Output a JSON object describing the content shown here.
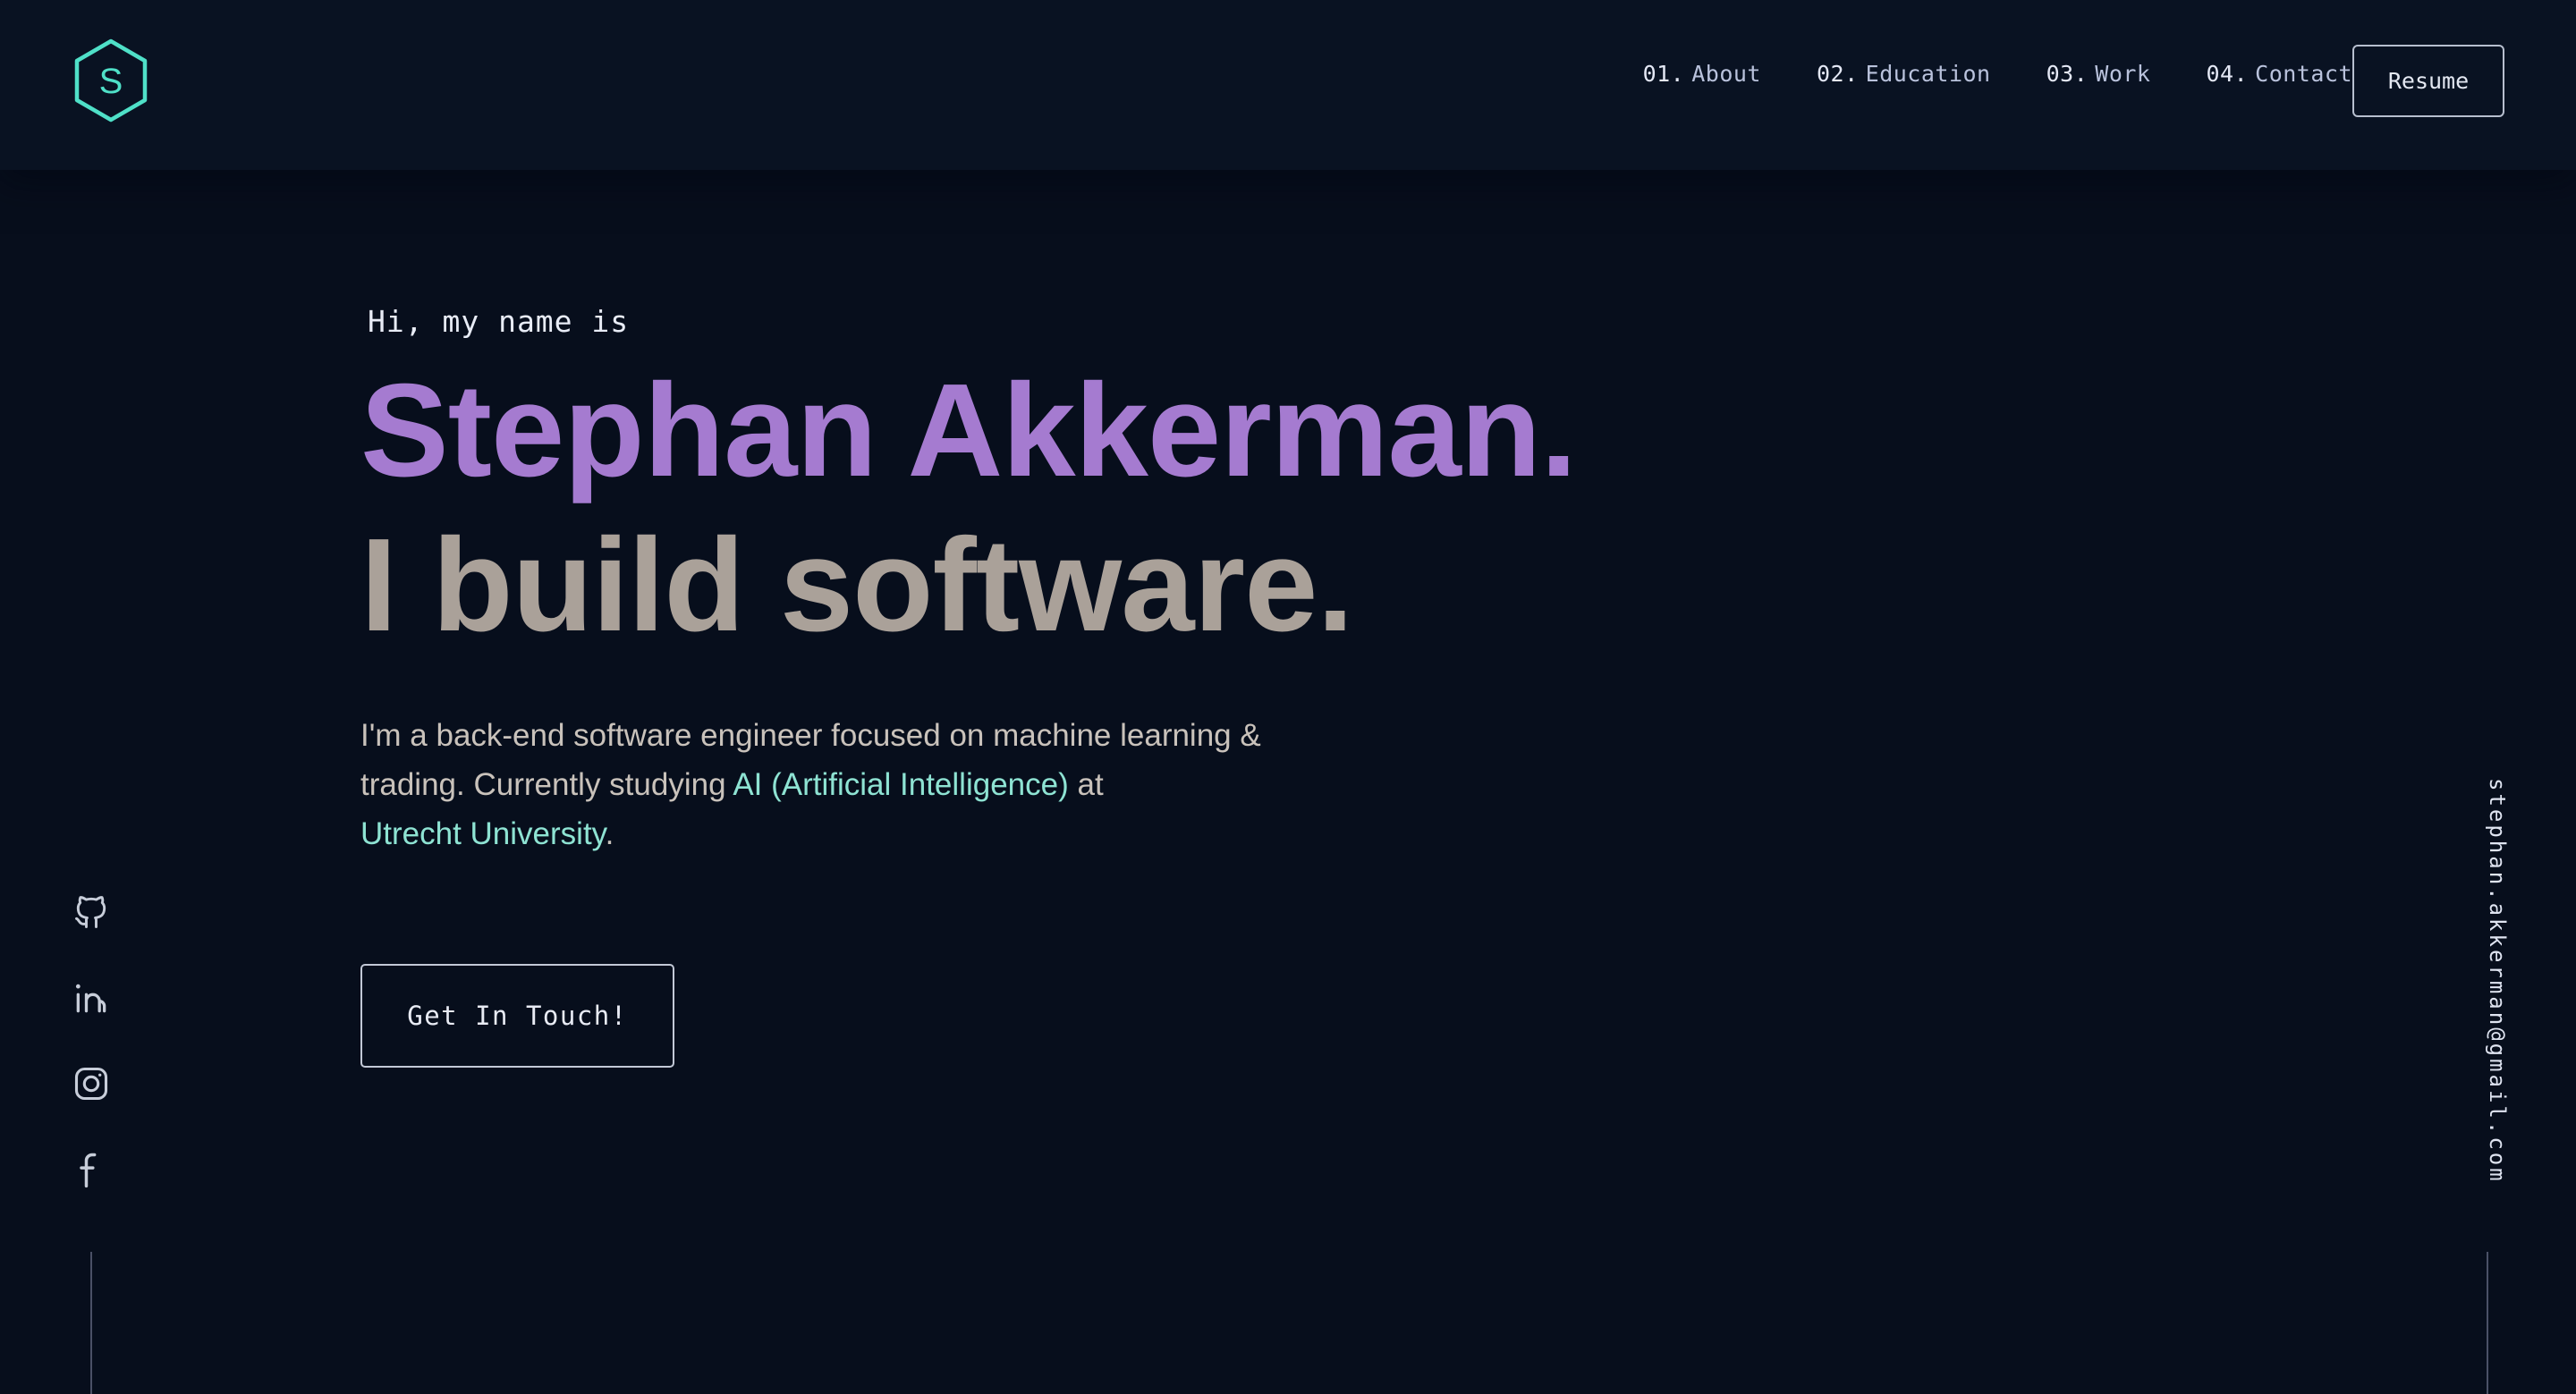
{
  "header": {
    "logo_letter": "S",
    "nav": [
      {
        "num": "01.",
        "label": "About"
      },
      {
        "num": "02.",
        "label": "Education"
      },
      {
        "num": "03.",
        "label": "Work"
      },
      {
        "num": "04.",
        "label": "Contact"
      }
    ],
    "resume_label": "Resume"
  },
  "hero": {
    "greeting": "Hi, my name is",
    "name": "Stephan Akkerman.",
    "tagline": "I build software.",
    "bio": {
      "line1": "I'm a back-end software engineer focused on machine learning &",
      "line2_pre": "trading. Currently studying ",
      "line2_highlight": "AI (Artificial Intelligence)",
      "line2_post": " at",
      "line3_highlight": "Utrecht University",
      "line3_post": "."
    },
    "cta_label": "Get In Touch!"
  },
  "socials": [
    {
      "icon": "github-icon"
    },
    {
      "icon": "linkedin-icon"
    },
    {
      "icon": "instagram-icon"
    },
    {
      "icon": "facebook-icon"
    }
  ],
  "email": "stephan.akkerman@gmail.com",
  "colors": {
    "background": "#070e1c",
    "accent_teal": "#64ffda",
    "name_purple": "#a57bd0",
    "tagline_gray": "#aaa199"
  }
}
